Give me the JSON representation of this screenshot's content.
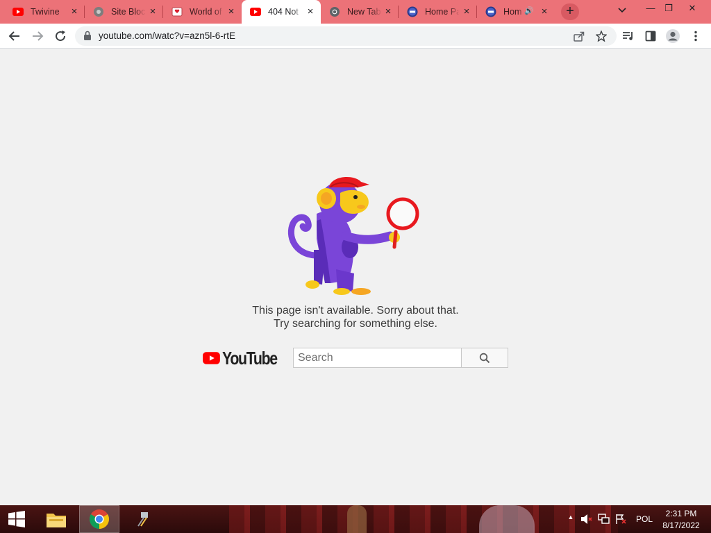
{
  "browser": {
    "tabs": [
      {
        "title": "Twivine",
        "favicon": "youtube-icon",
        "active": false,
        "audio": false
      },
      {
        "title": "Site Blocked",
        "favicon": "globe-icon",
        "active": false,
        "audio": false
      },
      {
        "title": "World of",
        "favicon": "cards-icon",
        "active": false,
        "audio": false
      },
      {
        "title": "404 Not",
        "favicon": "youtube-icon",
        "active": true,
        "audio": false
      },
      {
        "title": "New Tab",
        "favicon": "chrome-icon",
        "active": false,
        "audio": false
      },
      {
        "title": "Home Pa",
        "favicon": "pbs-kids-icon",
        "active": false,
        "audio": false
      },
      {
        "title": "Hom",
        "favicon": "pbs-kids-icon",
        "active": false,
        "audio": true
      }
    ],
    "new_tab_label": "+",
    "tab_menu_label": "⌄",
    "window_controls": {
      "minimize": "—",
      "restore": "❐",
      "close": "✕"
    },
    "address": {
      "url": "youtube.com/watc?v=azn5l-6-rtE"
    }
  },
  "page": {
    "message_line1": "This page isn't available. Sorry about that.",
    "message_line2": "Try searching for something else.",
    "logo_text": "YouTube",
    "search_placeholder": "Search",
    "search_value": ""
  },
  "taskbar": {
    "language": "POL",
    "time": "2:31 PM",
    "date": "8/17/2022",
    "tray_up_arrow": "▲"
  },
  "colors": {
    "tab_strip": "#ec7278",
    "youtube_red": "#ff0000",
    "monkey_purple": "#6f3ad0",
    "monkey_yellow": "#f7c81c"
  }
}
